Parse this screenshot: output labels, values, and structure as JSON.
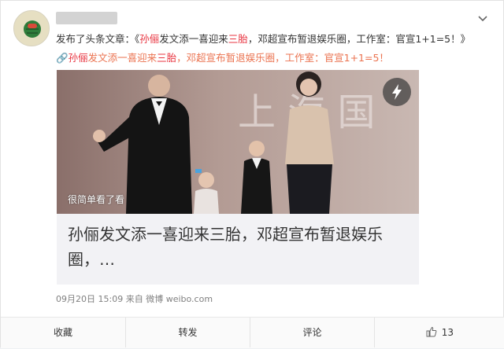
{
  "post": {
    "action_text": "发布了头条文章：《",
    "title_part1": "孙俪",
    "title_part2": "发文添一喜迎来",
    "title_part3": "三胎",
    "title_part4": "，邓超宣布暂退娱乐圈，工作室：官宣1+1=5！》",
    "link_prefix": "🔗",
    "link_part1": "孙俪",
    "link_part2": "发文添一喜迎来",
    "link_part3": "三胎",
    "link_part4": "，邓超宣布暂退娱乐圈，工作室：官宣1+1=5！"
  },
  "article": {
    "photo_backdrop_text": "上 海 国",
    "watermark": "很简单看了看",
    "headline": "孙俪发文添一喜迎来三胎，邓超宣布暂退娱乐圈，…"
  },
  "meta": {
    "time": "09月20日 15:09",
    "from_label": "来自",
    "source": "微博 weibo.com"
  },
  "actions": {
    "favorite": "收藏",
    "repost": "转发",
    "comment": "评论",
    "like_count": "13"
  },
  "colors": {
    "highlight": "#e8333f",
    "link": "#eb7350",
    "text": "#333333",
    "meta": "#808080"
  },
  "icons": {
    "top_right": "chevron-down-icon",
    "image_badge": "lightning-icon",
    "like": "thumbs-up-icon",
    "link": "link-icon"
  }
}
